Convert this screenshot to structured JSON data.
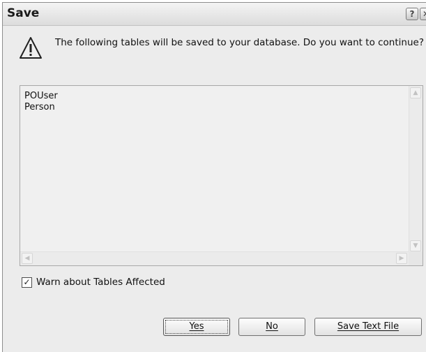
{
  "window": {
    "title": "Save",
    "help_glyph": "?",
    "close_glyph": "✕"
  },
  "message": "The following tables will be saved to your database. Do you want to continue?",
  "tables": [
    "POUser",
    "Person"
  ],
  "warn_option": {
    "label": "Warn about Tables Affected",
    "checked": true,
    "check_glyph": "✓"
  },
  "buttons": {
    "yes": "Yes",
    "no": "No",
    "save_text_file": "Save Text File"
  },
  "icons": {
    "warning": "warning-icon",
    "help": "help-icon",
    "close": "close-icon"
  },
  "colors": {
    "dialog_bg": "#ececec",
    "list_bg": "#f0f0f0",
    "warning_fill": "#f0f0f0",
    "warning_stroke": "#222222"
  }
}
